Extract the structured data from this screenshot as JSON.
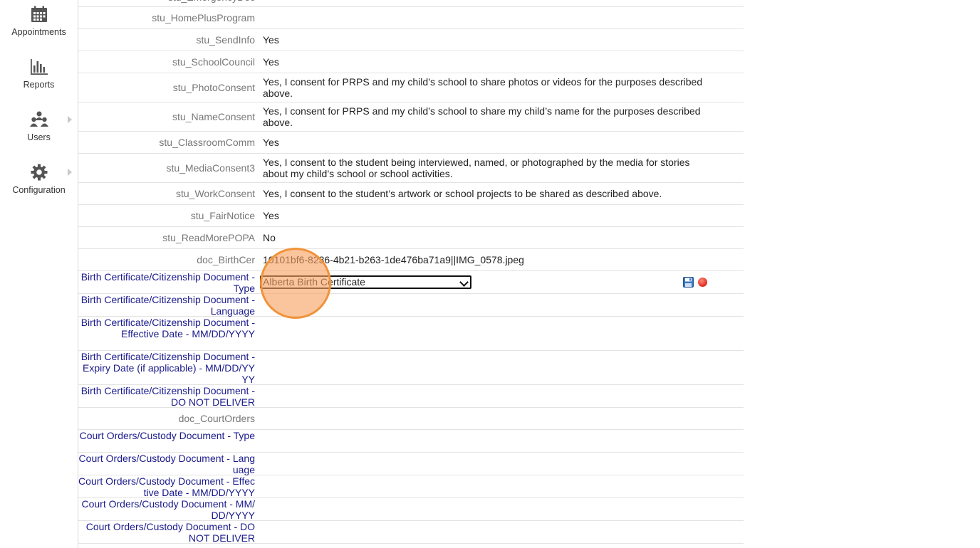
{
  "sidebar": {
    "items": [
      {
        "label": "Appointments",
        "icon": "calendar-icon"
      },
      {
        "label": "Reports",
        "icon": "bar-chart-icon"
      },
      {
        "label": "Users",
        "icon": "users-icon"
      },
      {
        "label": "Configuration",
        "icon": "gear-icon"
      }
    ]
  },
  "fields": {
    "partial": {
      "key": "stu_EmergencyDoc"
    },
    "homeplus": {
      "key": "stu_HomePlusProgram",
      "value": ""
    },
    "sendinfo": {
      "key": "stu_SendInfo",
      "value": "Yes"
    },
    "schoolcouncil": {
      "key": "stu_SchoolCouncil",
      "value": "Yes"
    },
    "photoconsent": {
      "key": "stu_PhotoConsent",
      "value": "Yes, I consent for PRPS and my child’s school to share photos or videos for the purposes described above."
    },
    "nameconsent": {
      "key": "stu_NameConsent",
      "value": "Yes, I consent for PRPS and my child’s school to share my child’s name for the purposes described above."
    },
    "classroomcomm": {
      "key": "stu_ClassroomComm",
      "value": "Yes"
    },
    "mediaconsent3": {
      "key": "stu_MediaConsent3",
      "value": "Yes, I consent to the student being interviewed, named, or photographed by the media for stories about my child’s school or school activities."
    },
    "workconsent": {
      "key": "stu_WorkConsent",
      "value": "Yes, I consent to the student’s artwork or school projects to be shared as described above."
    },
    "fairnotice": {
      "key": "stu_FairNotice",
      "value": "Yes"
    },
    "readmorepopa": {
      "key": "stu_ReadMorePOPA",
      "value": "No"
    },
    "birthcer": {
      "key": "doc_BirthCer",
      "value": "10101bf6-8236-4b21-b263-1de476ba71a9||IMG_0578.jpeg"
    },
    "bc_type": {
      "key": "Birth Certificate/Citizenship Document - Type",
      "selected": "Alberta Birth Certificate"
    },
    "bc_language": {
      "key": "Birth Certificate/Citizenship Document - Language",
      "value": ""
    },
    "bc_effective": {
      "key": "Birth Certificate/Citizenship Document - Effective Date - MM/DD/YYYY",
      "value": ""
    },
    "bc_expiry": {
      "key": "Birth Certificate/Citizenship Document - Expiry Date (if applicable) - MM/DD/YYYY",
      "value": ""
    },
    "bc_donotdeliver": {
      "key": "Birth Certificate/Citizenship Document - DO NOT DELIVER",
      "value": ""
    },
    "courtorders": {
      "key": "doc_CourtOrders",
      "value": ""
    },
    "co_type": {
      "key": "Court Orders/Custody Document - Type",
      "value": ""
    },
    "co_language": {
      "key": "Court Orders/Custody Document - Language",
      "value": ""
    },
    "co_effective": {
      "key": "Court Orders/Custody Document - Effective Date - MM/DD/YYYY",
      "value": ""
    },
    "co_expiry": {
      "key": "Court Orders/Custody Document - MM/DD/YYYY",
      "value": ""
    },
    "co_donotdeliver": {
      "key": "Court Orders/Custody Document - DO NOT DELIVER",
      "value": ""
    }
  },
  "colors": {
    "accent_label": "#1a1a8c",
    "muted_label": "#777777",
    "highlight": "#f0933a"
  }
}
